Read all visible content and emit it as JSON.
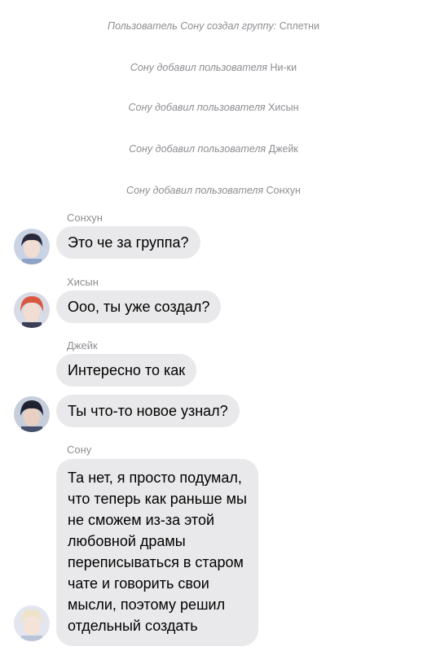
{
  "system_messages": [
    {
      "text": "Пользователь Сону создал группу:",
      "name": "Сплетни"
    },
    {
      "text": "Сону добавил пользователя",
      "name": "Ни-ки"
    },
    {
      "text": "Сону добавил пользователя",
      "name": "Хисын"
    },
    {
      "text": "Сону добавил пользователя",
      "name": "Джейк"
    },
    {
      "text": "Сону добавил пользователя",
      "name": "Сонхун"
    }
  ],
  "messages": [
    {
      "sender": "Сонхун",
      "text": "Это че за группа?"
    },
    {
      "sender": "Хисын",
      "text": "Ооо, ты уже создал?"
    },
    {
      "sender": "Джейк",
      "text": "Интересно то как"
    },
    {
      "text": "Ты что-то новое узнал?"
    },
    {
      "sender": "Сону",
      "lines": [
        "Та нет, я просто подумал,",
        "что теперь как раньше мы",
        "не сможем из-за этой",
        "любовной драмы",
        "переписываться в старом",
        "чате и говорить свои",
        "мысли, поэтому решил",
        "отдельный создать"
      ]
    }
  ],
  "avatars": {
    "sunghoon": "avatar-photo",
    "heeseung": "avatar-photo",
    "jake": "avatar-photo",
    "sunoo": "avatar-photo"
  },
  "colors": {
    "bubble": "#e9e9eb",
    "meta_text": "#8e8e93",
    "text": "#000000",
    "background": "#ffffff"
  }
}
